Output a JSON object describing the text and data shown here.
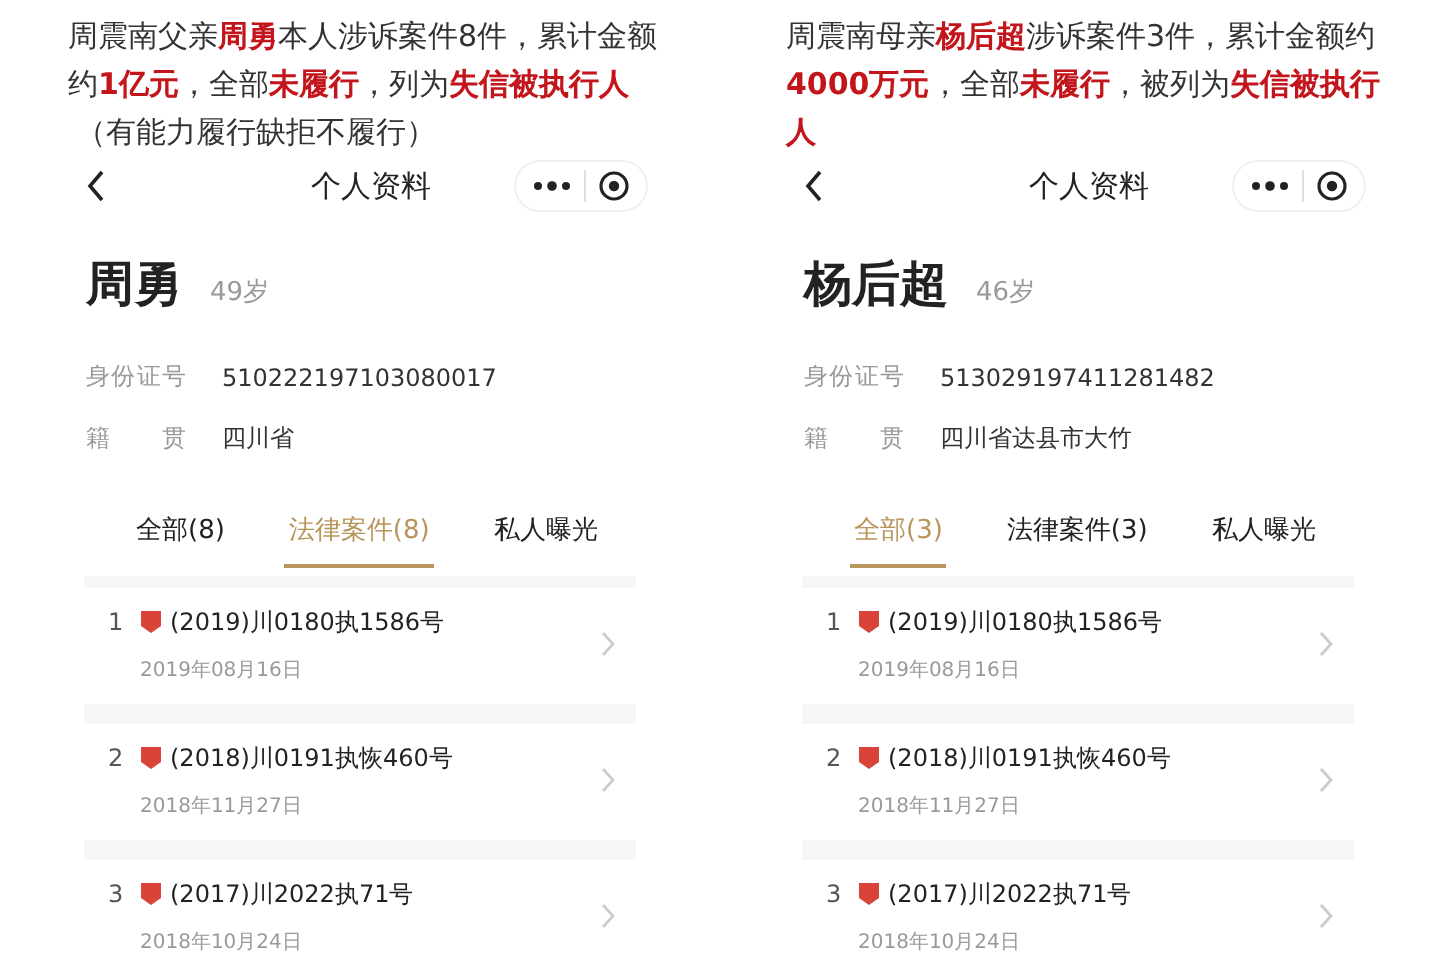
{
  "panels": [
    {
      "caption": "周震南父亲**周勇**本人涉诉案件8件，累计金额约**1亿元**，全部**未履行**，列为**失信被执行人**",
      "caption_note": "（有能力履行缺拒不履行）",
      "header": {
        "title": "个人资料"
      },
      "name": "周勇",
      "age": "49岁",
      "fields": [
        {
          "label": "身份证号",
          "value": "510222197103080017"
        },
        {
          "label": "籍贯",
          "value": "四川省"
        }
      ],
      "tabs": [
        {
          "label": "全部(8)",
          "selected": false
        },
        {
          "label": "法律案件(8)",
          "selected": true
        },
        {
          "label": "私人曝光",
          "selected": false
        }
      ],
      "cases": [
        {
          "index": "1",
          "title": "(2019)川0180执1586号",
          "date": "2019年08月16日"
        },
        {
          "index": "2",
          "title": "(2018)川0191执恢460号",
          "date": "2018年11月27日"
        },
        {
          "index": "3",
          "title": "(2017)川2022执71号",
          "date": "2018年10月24日"
        }
      ]
    },
    {
      "caption": "周震南母亲**杨后超**涉诉案件3件，累计金额约**4000万元**，全部**未履行**，被列为**失信被执行人**",
      "header": {
        "title": "个人资料"
      },
      "name": "杨后超",
      "age": "46岁",
      "fields": [
        {
          "label": "身份证号",
          "value": "513029197411281482"
        },
        {
          "label": "籍贯",
          "value": "四川省达县市大竹"
        }
      ],
      "tabs": [
        {
          "label": "全部(3)",
          "selected": true
        },
        {
          "label": "法律案件(3)",
          "selected": false
        },
        {
          "label": "私人曝光",
          "selected": false
        }
      ],
      "cases": [
        {
          "index": "1",
          "title": "(2019)川0180执1586号",
          "date": "2019年08月16日"
        },
        {
          "index": "2",
          "title": "(2018)川0191执恢460号",
          "date": "2018年11月27日"
        },
        {
          "index": "3",
          "title": "(2017)川2022执71号",
          "date": "2018年10月24日"
        }
      ]
    }
  ]
}
